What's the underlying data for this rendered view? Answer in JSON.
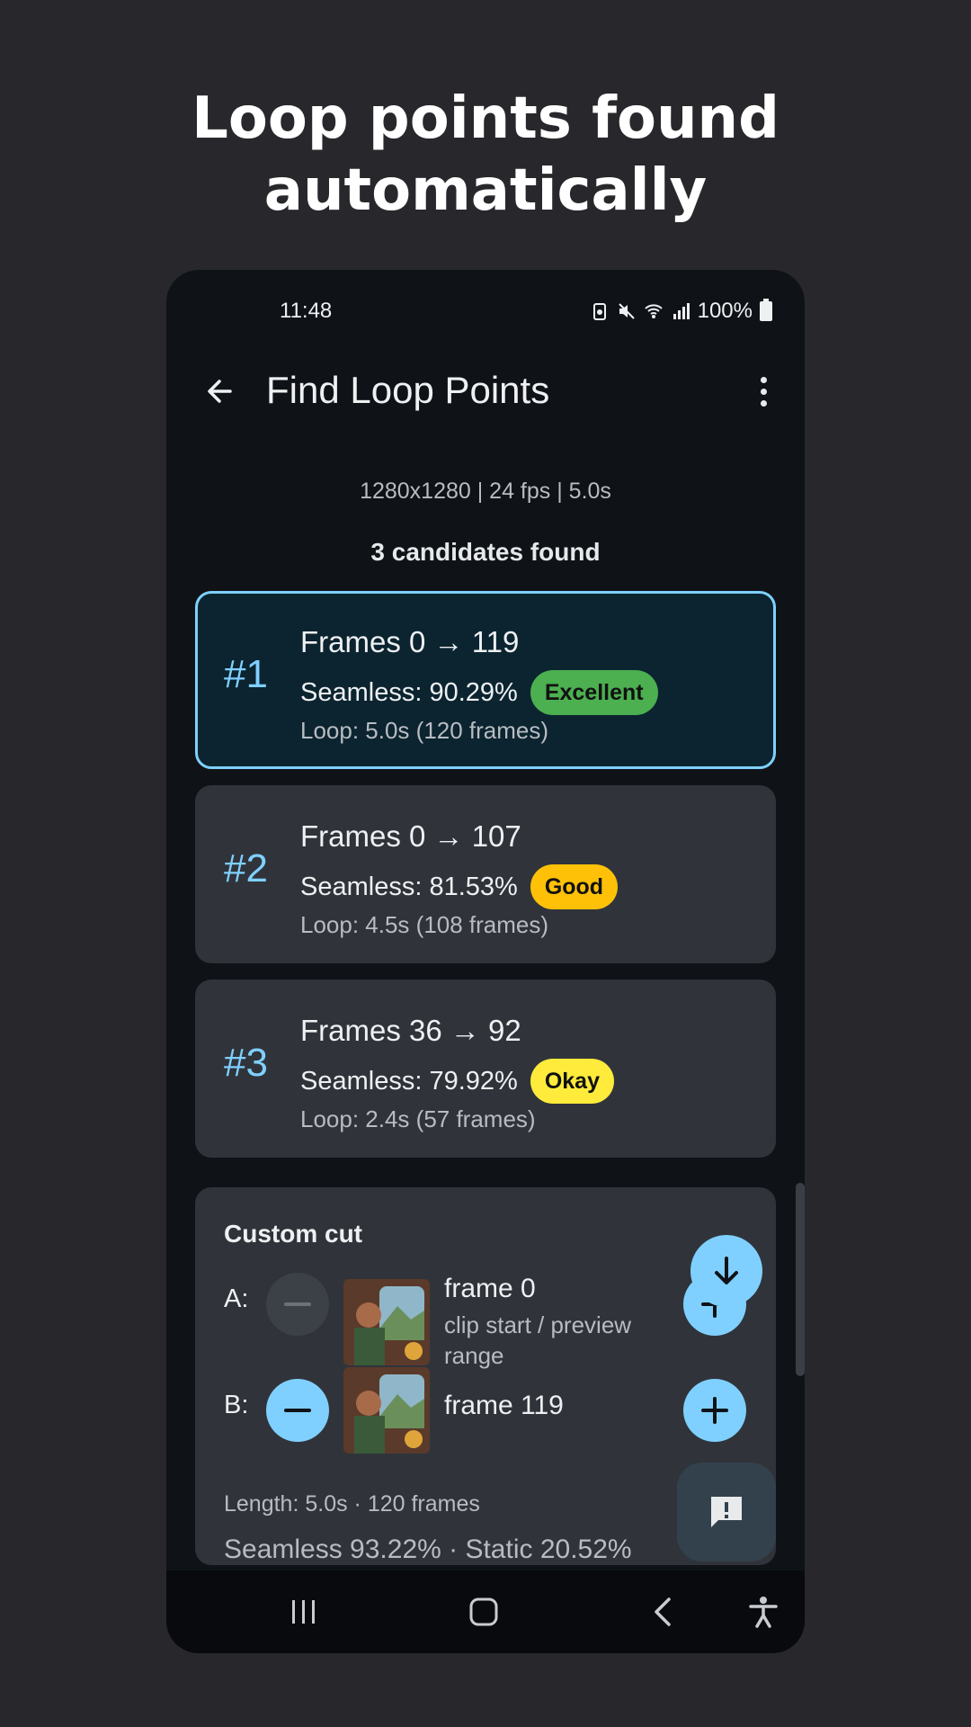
{
  "headline": {
    "line1": "Loop points found",
    "line2": "automatically"
  },
  "status_bar": {
    "time": "11:48",
    "battery": "100%"
  },
  "app_bar": {
    "title": "Find Loop Points"
  },
  "video_meta": "1280x1280 | 24 fps | 5.0s",
  "candidates_count": "3 candidates found",
  "candidates": [
    {
      "rank": "#1",
      "frames": "Frames 0 → 119",
      "seamless": "Seamless: 90.29%",
      "badge": "Excellent",
      "badge_color": "#4caf50",
      "loop": "Loop: 5.0s (120 frames)",
      "selected": true
    },
    {
      "rank": "#2",
      "frames": "Frames 0 → 107",
      "seamless": "Seamless: 81.53%",
      "badge": "Good",
      "badge_color": "#ffc107",
      "loop": "Loop: 4.5s (108 frames)",
      "selected": false
    },
    {
      "rank": "#3",
      "frames": "Frames 36 → 92",
      "seamless": "Seamless: 79.92%",
      "badge": "Okay",
      "badge_color": "#ffeb3b",
      "loop": "Loop: 2.4s (57 frames)",
      "selected": false
    }
  ],
  "custom_cut": {
    "title": "Custom cut",
    "a": {
      "label": "A:",
      "frame": "frame 0",
      "note": "clip start / preview range"
    },
    "b": {
      "label": "B:",
      "frame": "frame 119"
    },
    "length": "Length: 5.0s · 120 frames",
    "seamless_static": "Seamless 93.22% · Static 20.52%"
  },
  "colors": {
    "accent": "#7fd0ff",
    "background": "#0f1318",
    "card": "#30343a",
    "selected_card": "#0b2430"
  },
  "icons": [
    "back-arrow-icon",
    "more-vert-icon",
    "minus-icon",
    "plus-icon",
    "arrow-down-icon",
    "feedback-icon",
    "recents-icon",
    "home-icon",
    "nav-back-icon",
    "accessibility-icon"
  ]
}
